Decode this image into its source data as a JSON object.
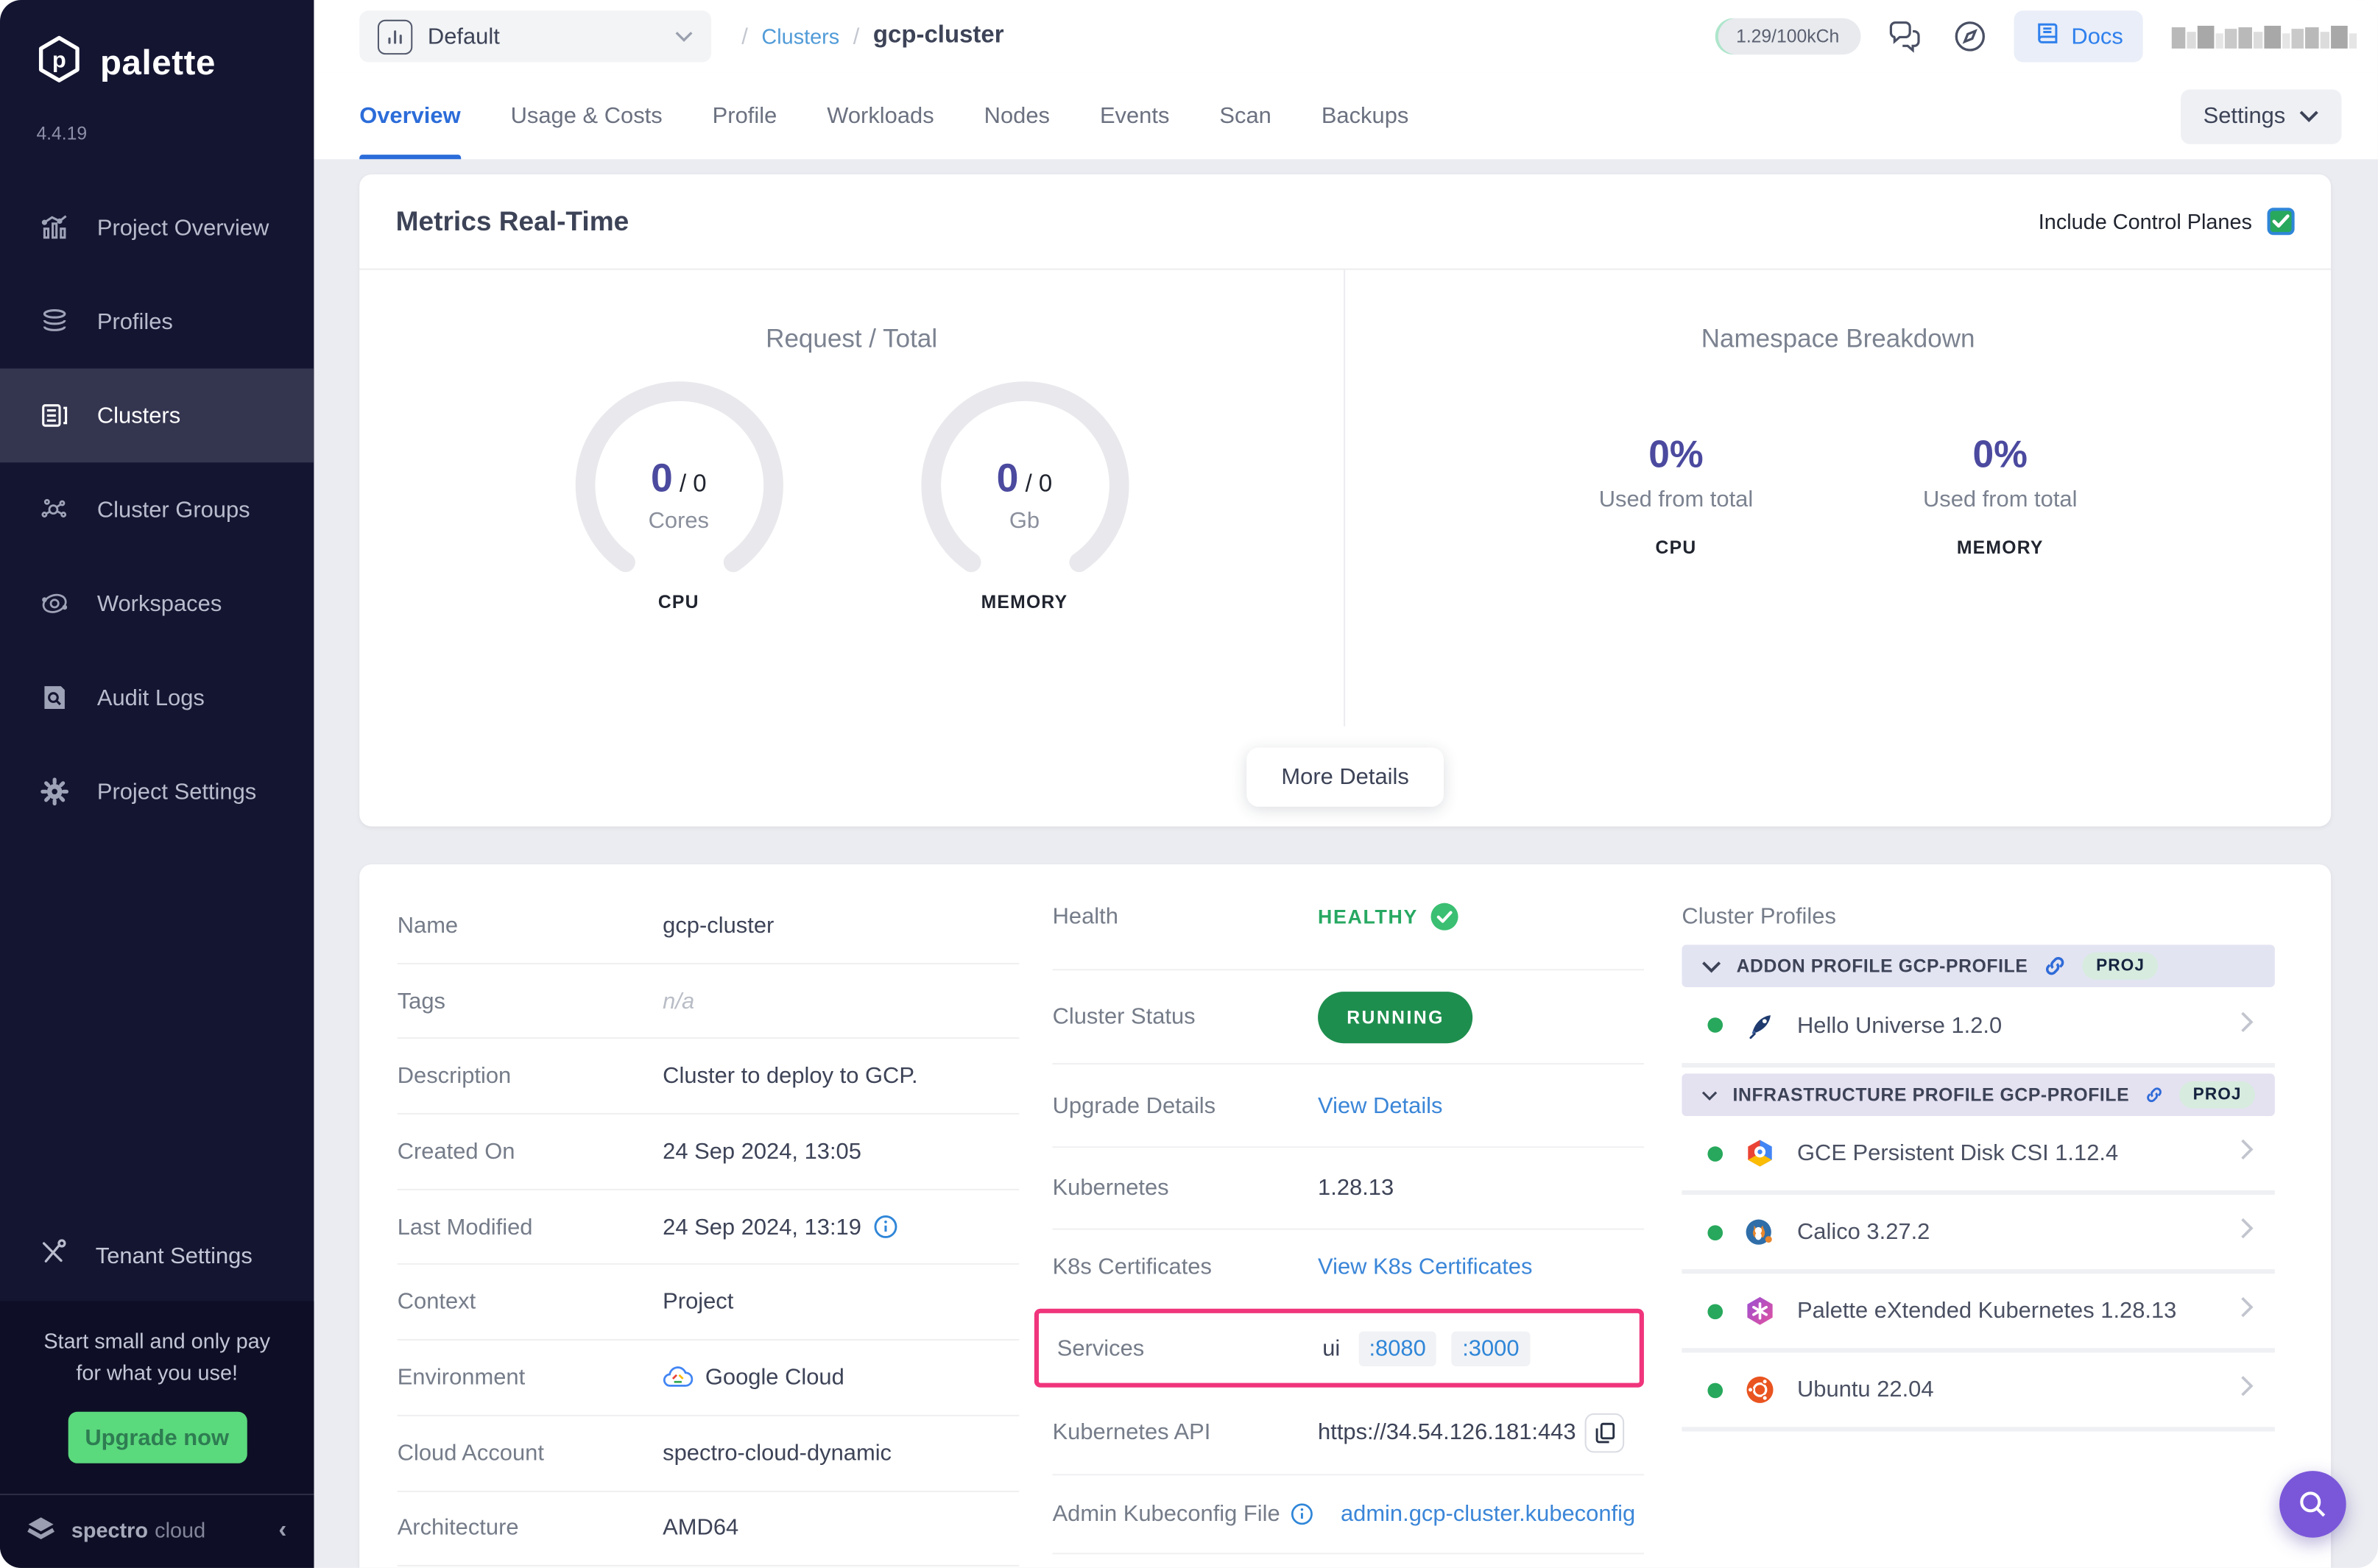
{
  "sidebar": {
    "brand": "palette",
    "version": "4.4.19",
    "items": [
      {
        "label": "Project Overview"
      },
      {
        "label": "Profiles"
      },
      {
        "label": "Clusters"
      },
      {
        "label": "Cluster Groups"
      },
      {
        "label": "Workspaces"
      },
      {
        "label": "Audit Logs"
      },
      {
        "label": "Project Settings"
      }
    ],
    "active_item": "Clusters",
    "tenant_settings": "Tenant Settings",
    "promo": {
      "message_line1": "Start small and only pay",
      "message_line2": "for what you use!",
      "button": "Upgrade now"
    },
    "footer": {
      "brand_primary": "spectro",
      "brand_secondary": "cloud"
    }
  },
  "topbar": {
    "project_selector": {
      "label": "Default"
    },
    "breadcrumb": {
      "slash1": "/",
      "section": "Clusters",
      "slash2": "/",
      "current": "gcp-cluster"
    },
    "usage_pill": "1.29/100kCh",
    "docs_button": "Docs"
  },
  "tabs": {
    "items": [
      {
        "label": "Overview"
      },
      {
        "label": "Usage & Costs"
      },
      {
        "label": "Profile"
      },
      {
        "label": "Workloads"
      },
      {
        "label": "Nodes"
      },
      {
        "label": "Events"
      },
      {
        "label": "Scan"
      },
      {
        "label": "Backups"
      }
    ],
    "active": "Overview",
    "settings_button": "Settings"
  },
  "metrics": {
    "title": "Metrics Real-Time",
    "include_control_planes": "Include Control Planes",
    "control_planes_checked": true,
    "request_total": {
      "title": "Request / Total",
      "gauges": [
        {
          "value": "0",
          "separator": "/ ",
          "total": "0",
          "unit": "Cores",
          "metric": "CPU"
        },
        {
          "value": "0",
          "separator": "/ ",
          "total": "0",
          "unit": "Gb",
          "metric": "MEMORY"
        }
      ]
    },
    "namespace_breakdown": {
      "title": "Namespace Breakdown",
      "stats": [
        {
          "percent": "0%",
          "caption": "Used from total",
          "metric": "CPU"
        },
        {
          "percent": "0%",
          "caption": "Used from total",
          "metric": "MEMORY"
        }
      ]
    },
    "more_details_button": "More Details"
  },
  "details": {
    "left": [
      {
        "label": "Name",
        "value": "gcp-cluster"
      },
      {
        "label": "Tags",
        "value": "n/a"
      },
      {
        "label": "Description",
        "value": "Cluster to deploy to GCP."
      },
      {
        "label": "Created On",
        "value": "24 Sep 2024, 13:05"
      },
      {
        "label": "Last Modified",
        "value": "24 Sep 2024, 13:19"
      },
      {
        "label": "Context",
        "value": "Project"
      },
      {
        "label": "Environment",
        "value": "Google Cloud"
      },
      {
        "label": "Cloud Account",
        "value": "spectro-cloud-dynamic"
      },
      {
        "label": "Architecture",
        "value": "AMD64"
      }
    ],
    "health": {
      "label": "Health",
      "value": "HEALTHY"
    },
    "cluster_status": {
      "label": "Cluster Status",
      "value": "RUNNING"
    },
    "upgrade_details": {
      "label": "Upgrade Details",
      "link": "View Details"
    },
    "kubernetes": {
      "label": "Kubernetes",
      "value": "1.28.13"
    },
    "k8s_certificates": {
      "label": "K8s Certificates",
      "link": "View K8s Certificates"
    },
    "services": {
      "label": "Services",
      "name": "ui",
      "ports": [
        ":8080",
        ":3000"
      ],
      "highlight_color": "#f0357c"
    },
    "kubernetes_api": {
      "label": "Kubernetes API",
      "value": "https://34.54.126.181:443"
    },
    "admin_kubeconfig": {
      "label": "Admin Kubeconfig File",
      "link": "admin.gcp-cluster.kubeconfig"
    }
  },
  "cluster_profiles": {
    "title": "Cluster Profiles",
    "sections": [
      {
        "header": "ADDON PROFILE GCP-PROFILE",
        "badge": "PROJ",
        "items": [
          {
            "name": "Hello Universe 1.2.0",
            "icon": "hello-universe-rocket",
            "status_color": "#27a85c"
          }
        ]
      },
      {
        "header": "INFRASTRUCTURE PROFILE GCP-PROFILE",
        "badge": "PROJ",
        "items": [
          {
            "name": "GCE Persistent Disk CSI 1.12.4",
            "icon": "gce-hexagon",
            "status_color": "#27a85c"
          },
          {
            "name": "Calico 3.27.2",
            "icon": "calico-cat",
            "status_color": "#27a85c"
          },
          {
            "name": "Palette eXtended Kubernetes 1.28.13",
            "icon": "pxk-hexagon",
            "status_color": "#27a85c"
          },
          {
            "name": "Ubuntu 22.04",
            "icon": "ubuntu-logo",
            "status_color": "#27a85c"
          }
        ]
      }
    ]
  },
  "colors": {
    "accent_blue": "#2b6cd9",
    "link_blue": "#3b86d8",
    "purple": "#4b4a9f",
    "green": "#27a85c",
    "running_green": "#1e8e4e",
    "highlight_pink": "#f0357c",
    "sidebar_bg": "#141531",
    "upgrade_green": "#5bd97d",
    "fab_purple": "#7a57d9"
  }
}
